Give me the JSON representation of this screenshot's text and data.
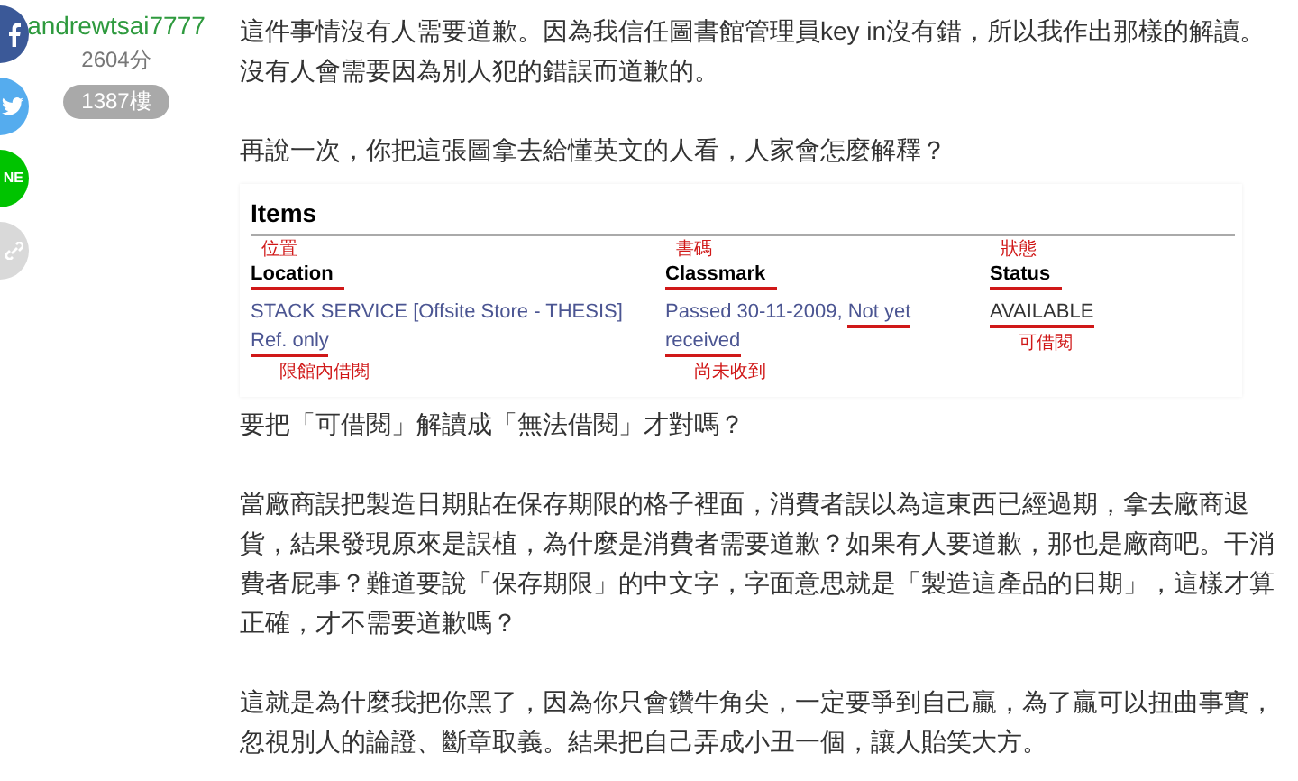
{
  "author": {
    "username": "andrewtsai7777",
    "score": "2604分",
    "floor": "1387樓"
  },
  "share_buttons": [
    {
      "kind": "facebook",
      "color": "#3b5998"
    },
    {
      "kind": "twitter",
      "color": "#55acee"
    },
    {
      "kind": "line",
      "color": "#00c300",
      "label": "NE"
    },
    {
      "kind": "link",
      "color": "#d9d9d9"
    }
  ],
  "paragraphs_before": [
    [
      "這件事情沒有人需要道歉。因為我信任圖書館管理員key in沒有錯，所以我作出那樣的解讀。",
      "沒有人會需要因為別人犯的錯誤而道歉的。"
    ],
    [
      "再說一次，你把這張圖拿去給懂英文的人看，人家會怎麼解釋？"
    ]
  ],
  "catalog": {
    "title": "Items",
    "columns": [
      {
        "annotation": "位置",
        "header": "Location",
        "is_link": true,
        "value_parts": [
          {
            "text": "STACK SERVICE [Offsite Store - THESIS] ",
            "underlined": false
          },
          {
            "text": "Ref. only",
            "underlined": true
          }
        ],
        "note": "限館內借閱"
      },
      {
        "annotation": "書碼",
        "header": "Classmark",
        "is_link": true,
        "value_parts": [
          {
            "text": "Passed 30-11-2009, ",
            "underlined": false
          },
          {
            "text": "Not yet received",
            "underlined": true
          }
        ],
        "note": "尚未收到"
      },
      {
        "annotation": "狀態",
        "header": "Status",
        "is_link": false,
        "value_parts": [
          {
            "text": "AVAILABLE",
            "underlined": true
          }
        ],
        "note": "可借閱"
      }
    ]
  },
  "paragraphs_after": [
    "要把「可借閱」解讀成「無法借閱」才對嗎？",
    "當廠商誤把製造日期貼在保存期限的格子裡面，消費者誤以為這東西已經過期，拿去廠商退貨，結果發現原來是誤植，為什麼是消費者需要道歉？如果有人要道歉，那也是廠商吧。干消費者屁事？難道要說「保存期限」的中文字，字面意思就是「製造這產品的日期」，這樣才算正確，才不需要道歉嗎？",
    "這就是為什麼我把你黑了，因為你只會鑽牛角尖，一定要爭到自己贏，為了贏可以扭曲事實，忽視別人的論證、斷章取義。結果把自己弄成小丑一個，讓人貽笑大方。"
  ]
}
